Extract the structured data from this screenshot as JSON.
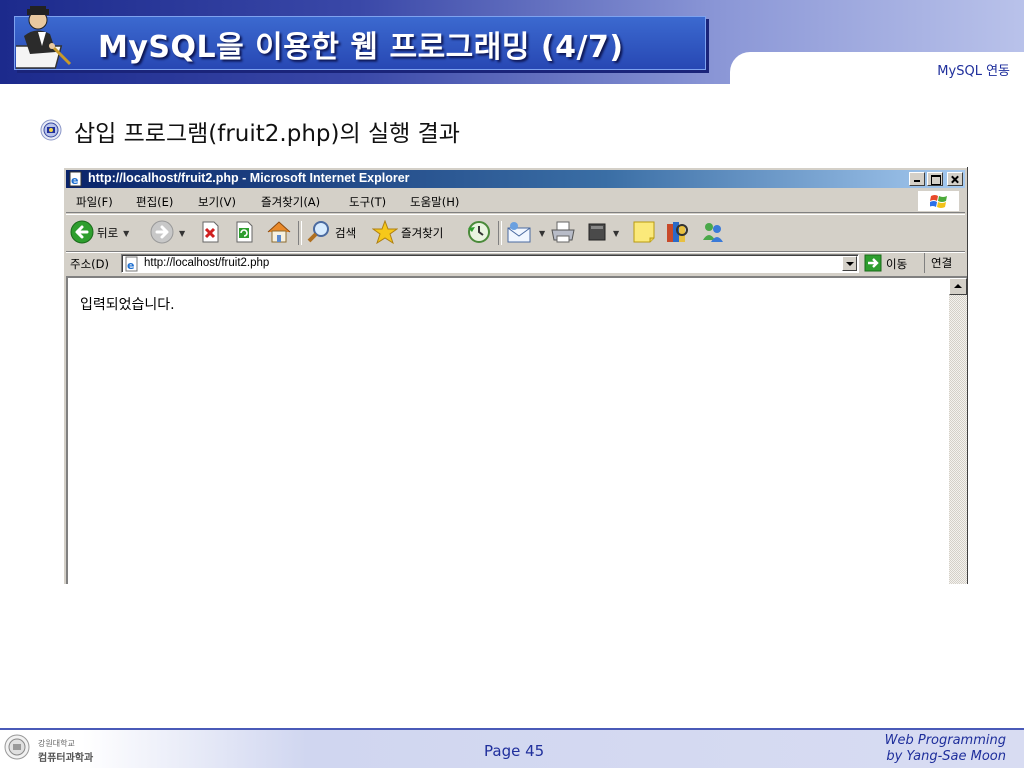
{
  "slide": {
    "title": "MySQL을 이용한 웹 프로그래밍 (4/7)",
    "section_tab": "MySQL 연동",
    "bullet_text": "삽입 프로그램(fruit2.php)의 실행 결과"
  },
  "browser": {
    "window_title": "http://localhost/fruit2.php - Microsoft Internet Explorer",
    "menu": [
      "파일(F)",
      "편집(E)",
      "보기(V)",
      "즐겨찾기(A)",
      "도구(T)",
      "도움말(H)"
    ],
    "toolbar": {
      "back_label": "뒤로",
      "search_label": "검색",
      "favorites_label": "즐겨찾기"
    },
    "address_label": "주소(D)",
    "address_value": "http://localhost/fruit2.php",
    "go_label": "이동",
    "links_label": "연결",
    "page_content": "입력되었습니다."
  },
  "footer": {
    "dept_line1": "강원대학교",
    "dept_line2": "컴퓨터과학과",
    "page_label": "Page 45",
    "course_line1": "Web Programming",
    "course_line2": "by Yang-Sae Moon"
  },
  "colors": {
    "header_dark": "#1c2a8c",
    "title_box": "#2747b3",
    "accent_text": "#1f2f9c",
    "ie_titlebar": "#0a246a",
    "win_face": "#d4d0c8"
  },
  "icons": [
    "writer-figure-logo",
    "bullet-emblem-icon",
    "ie-page-icon",
    "windows-flag-icon",
    "back-arrow-icon",
    "forward-arrow-icon",
    "stop-icon",
    "refresh-icon",
    "home-icon",
    "search-icon",
    "favorites-star-icon",
    "history-icon",
    "mail-icon",
    "print-icon",
    "edit-icon",
    "discuss-icon",
    "research-icon",
    "messenger-icon",
    "go-arrow-icon",
    "university-seal-icon"
  ]
}
